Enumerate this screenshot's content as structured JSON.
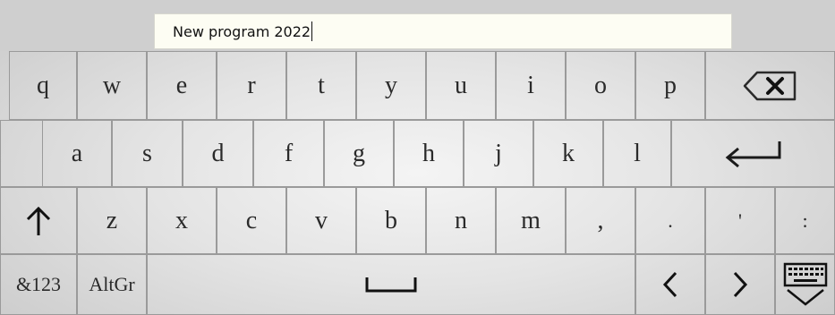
{
  "input": {
    "value": "New program 2022"
  },
  "rows": [
    [
      "q",
      "w",
      "e",
      "r",
      "t",
      "y",
      "u",
      "i",
      "o",
      "p"
    ],
    [
      "a",
      "s",
      "d",
      "f",
      "g",
      "h",
      "j",
      "k",
      "l"
    ],
    [
      "z",
      "x",
      "c",
      "v",
      "b",
      "n",
      "m",
      ",",
      ".",
      "'",
      ":"
    ]
  ],
  "bottom": {
    "symbols_label": "&123",
    "altgr_label": "AltGr"
  },
  "icons": {
    "backspace": "backspace-icon",
    "enter": "enter-icon",
    "shift": "shift-arrow-icon",
    "space": "space-bar-icon",
    "left": "arrow-left-icon",
    "right": "arrow-right-icon",
    "hide": "keyboard-hide-icon"
  },
  "colors": {
    "key_border": "#9a9a9a",
    "input_bg": "#fdfdf3"
  }
}
